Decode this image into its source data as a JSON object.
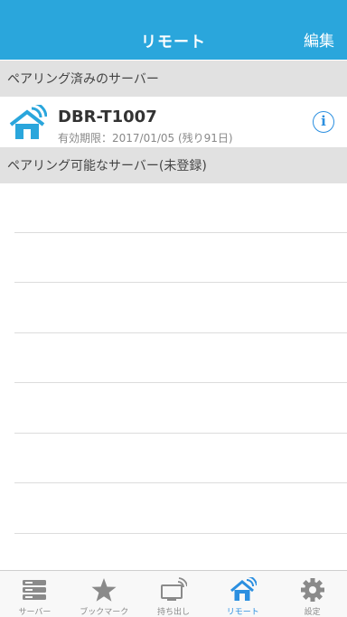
{
  "navbar": {
    "title": "リモート",
    "edit_label": "編集"
  },
  "sections": {
    "paired_header": "ペアリング済みのサーバー",
    "available_header": "ペアリング可能なサーバー(未登録)"
  },
  "paired_servers": [
    {
      "name": "DBR-T1007",
      "subtitle": "有効期限：2017/01/05 (残り91日)",
      "icon": "house-wifi-icon",
      "info_label": "i"
    }
  ],
  "tabbar": {
    "items": [
      {
        "label": "サーバー",
        "icon": "server-icon",
        "active": false
      },
      {
        "label": "ブックマーク",
        "icon": "star-icon",
        "active": false
      },
      {
        "label": "持ち出し",
        "icon": "takeout-icon",
        "active": false
      },
      {
        "label": "リモート",
        "icon": "remote-house-icon",
        "active": true
      },
      {
        "label": "設定",
        "icon": "gear-icon",
        "active": false
      }
    ]
  },
  "colors": {
    "navbar": "#2aa6dc",
    "accent": "#2b8fe0",
    "section_header_bg": "#e1e1e1",
    "tab_inactive": "#8a8a8a"
  }
}
